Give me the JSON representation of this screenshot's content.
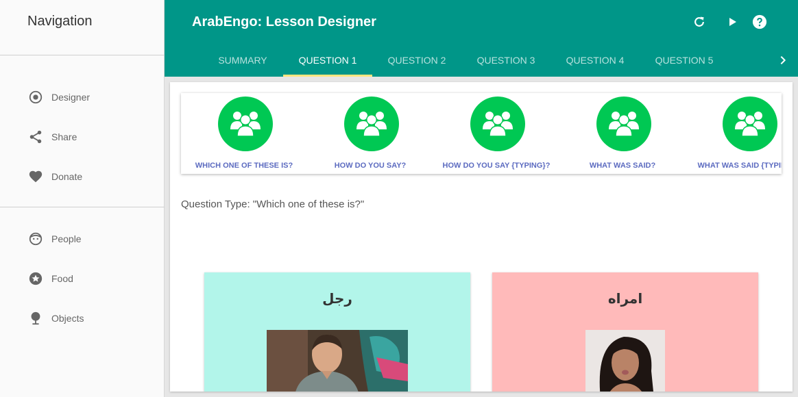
{
  "sidebar": {
    "title": "Navigation",
    "items": [
      {
        "label": "Designer",
        "icon": "radio-target-icon"
      },
      {
        "label": "Share",
        "icon": "share-icon"
      },
      {
        "label": "Donate",
        "icon": "heart-icon"
      },
      {
        "label": "People",
        "icon": "face-icon"
      },
      {
        "label": "Food",
        "icon": "star-icon"
      },
      {
        "label": "Objects",
        "icon": "pin-icon"
      }
    ]
  },
  "header": {
    "title": "ArabEngo: Lesson Designer",
    "actions": [
      "refresh-icon",
      "play-icon",
      "help-icon"
    ],
    "tabs": [
      "SUMMARY",
      "QUESTION 1",
      "QUESTION 2",
      "QUESTION 3",
      "QUESTION 4",
      "QUESTION 5"
    ],
    "active_tab": "QUESTION 1"
  },
  "question_types": [
    {
      "label": "WHICH ONE OF THESE IS?"
    },
    {
      "label": "HOW DO YOU SAY?"
    },
    {
      "label": "HOW DO YOU SAY {TYPING}?"
    },
    {
      "label": "WHAT WAS SAID?"
    },
    {
      "label": "WHAT WAS SAID {TYPING}?"
    }
  ],
  "question_type_text": "Question Type: \"Which one of these is?\"",
  "cards": [
    {
      "word": "رجل",
      "color": "#b2f5ea"
    },
    {
      "word": "امراه",
      "color": "#ffbaba"
    }
  ],
  "colors": {
    "primary": "#009688",
    "accent": "#ffe57f",
    "qtype_green": "#00c853",
    "qtype_label": "#5c6bc0"
  }
}
